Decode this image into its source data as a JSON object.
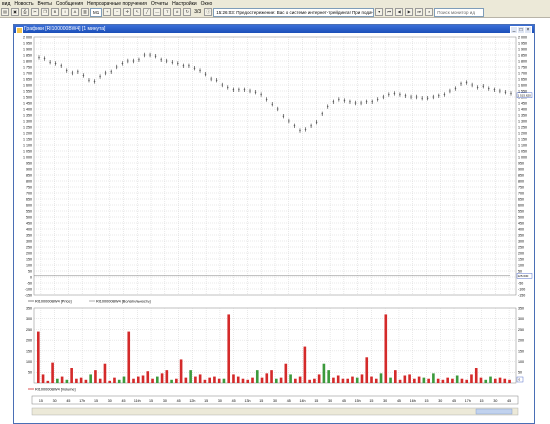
{
  "menu": [
    "вид",
    "Новость",
    "Вчеты",
    "Сообщения",
    "Непрозрачные поручения",
    "Отчеты",
    "Настройки",
    "Окно"
  ],
  "toolbar": {
    "interval": "M1",
    "page": "3/3",
    "news_ticker": "15:26:03: Предостережение: Вас о системе интернет-трейдинга!  При подаче пор",
    "search_placeholder": "Поиск монитор ид"
  },
  "window": {
    "title": "Графики [RI100000BW4]   [1 минута]"
  },
  "price_panel": {
    "legend": [
      "RI100000BW4 [Price]",
      "RI100000BW4 [Волатильность]"
    ],
    "current_value": "1 515.620",
    "y_ticks": [
      2000,
      1950,
      1900,
      1850,
      1800,
      1750,
      1700,
      1650,
      1600,
      1550,
      1500,
      1450,
      1400,
      1350,
      1300,
      1250,
      1200,
      1150,
      1100,
      1050,
      1000,
      950,
      900,
      850,
      800,
      750,
      700,
      650,
      600,
      550,
      500,
      450,
      400,
      350,
      300,
      250,
      200,
      150,
      100,
      50,
      0,
      -50,
      -100,
      -150
    ]
  },
  "volume_panel": {
    "legend": "RI100000BW4 [Volume]",
    "y_ticks": [
      350,
      300,
      250,
      200,
      150,
      100,
      50
    ],
    "right_marker": "0"
  },
  "time_axis": {
    "labels": [
      "15",
      "30",
      "45",
      "17h",
      "15",
      "30",
      "45",
      "11th",
      "15",
      "30",
      "45",
      "12h",
      "15",
      "30",
      "45",
      "13h",
      "15",
      "30",
      "45",
      "14h",
      "15",
      "30",
      "45",
      "15h",
      "15",
      "30",
      "45",
      "16h",
      "15",
      "30",
      "45",
      "17h",
      "15",
      "30",
      "45"
    ]
  },
  "chart_data": {
    "type": "line",
    "xlabel": "",
    "ylabel": "",
    "price": {
      "name": "RI100000BW4 [Price]",
      "ylim": [
        -150,
        2000
      ],
      "values": [
        1830,
        1820,
        1790,
        1780,
        1760,
        1720,
        1700,
        1710,
        1680,
        1640,
        1630,
        1670,
        1700,
        1710,
        1750,
        1780,
        1800,
        1800,
        1810,
        1850,
        1850,
        1840,
        1810,
        1800,
        1790,
        1780,
        1760,
        1760,
        1740,
        1720,
        1690,
        1650,
        1640,
        1600,
        1580,
        1560,
        1560,
        1560,
        1550,
        1540,
        1520,
        1480,
        1440,
        1400,
        1340,
        1300,
        1260,
        1220,
        1230,
        1260,
        1290,
        1360,
        1420,
        1460,
        1480,
        1470,
        1460,
        1450,
        1450,
        1460,
        1460,
        1480,
        1500,
        1520,
        1530,
        1520,
        1510,
        1500,
        1500,
        1490,
        1490,
        1500,
        1510,
        1520,
        1550,
        1570,
        1610,
        1620,
        1600,
        1580,
        1590,
        1570,
        1560,
        1550,
        1540,
        1530
      ]
    },
    "volume": {
      "name": "RI100000BW4 [Volume]",
      "ylim": [
        0,
        350
      ],
      "values": [
        240,
        40,
        10,
        95,
        20,
        30,
        15,
        70,
        20,
        25,
        15,
        40,
        60,
        20,
        90,
        10,
        25,
        15,
        30,
        240,
        20,
        30,
        35,
        55,
        20,
        30,
        45,
        60,
        15,
        20,
        110,
        25,
        60,
        30,
        40,
        15,
        25,
        30,
        20,
        20,
        320,
        40,
        30,
        20,
        15,
        25,
        60,
        25,
        45,
        60,
        20,
        25,
        90,
        40,
        20,
        30,
        170,
        15,
        20,
        40,
        90,
        60,
        25,
        35,
        20,
        20,
        30,
        25,
        40,
        120,
        30,
        20,
        45,
        320,
        25,
        60,
        15,
        35,
        40,
        20,
        30,
        25,
        20,
        45,
        20,
        15,
        25,
        20,
        35,
        20,
        15,
        40,
        70,
        25,
        15,
        30,
        20,
        25,
        20,
        15
      ]
    }
  }
}
